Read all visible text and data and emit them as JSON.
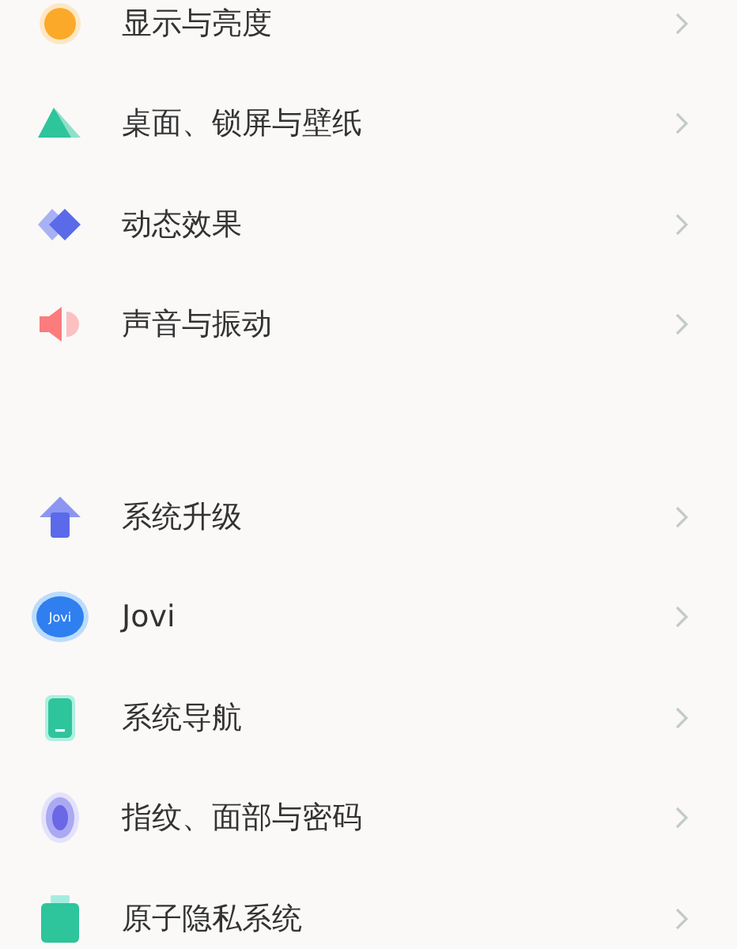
{
  "groups": [
    {
      "items": [
        {
          "label": "显示与亮度"
        },
        {
          "label": "桌面、锁屏与壁纸"
        },
        {
          "label": "动态效果"
        },
        {
          "label": "声音与振动"
        }
      ]
    },
    {
      "items": [
        {
          "label": "系统升级"
        },
        {
          "icon_text": "Jovi",
          "label": "Jovi"
        },
        {
          "label": "系统导航"
        },
        {
          "label": "指纹、面部与密码"
        },
        {
          "label": "原子隐私系统"
        }
      ]
    }
  ]
}
